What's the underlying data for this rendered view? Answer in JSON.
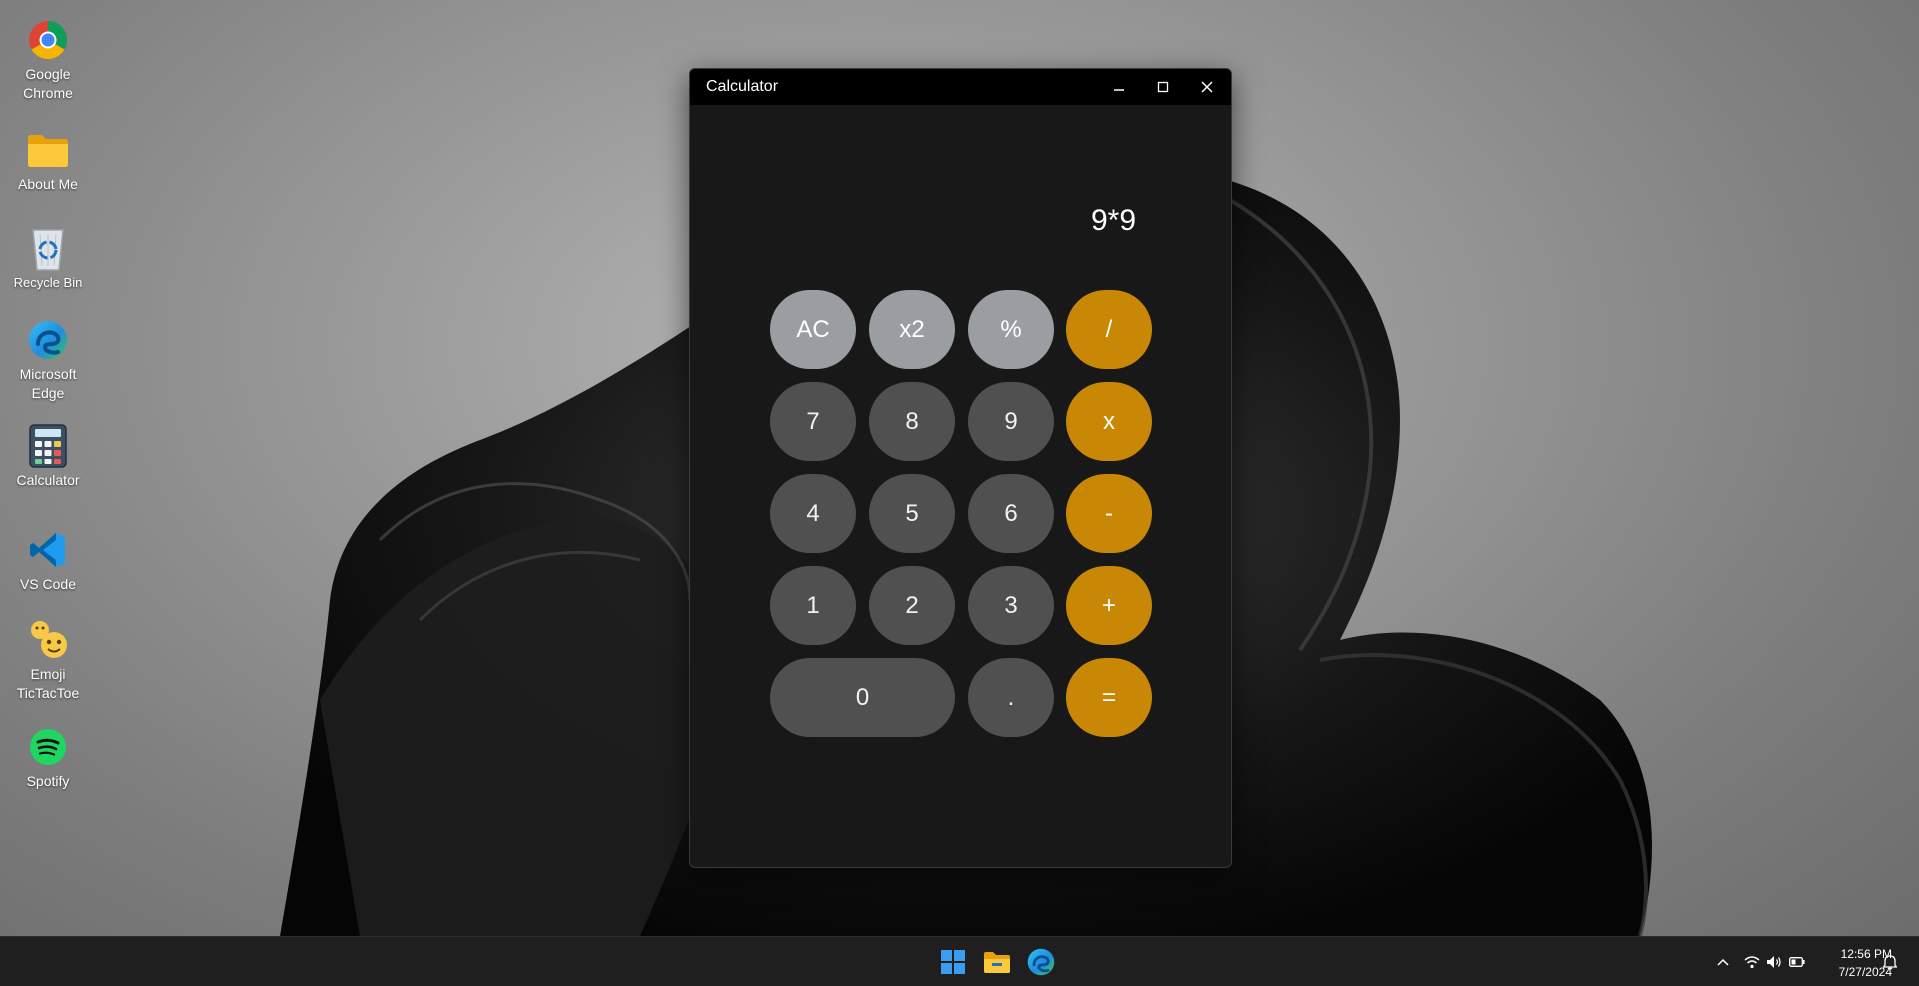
{
  "desktop": {
    "icons": [
      {
        "label": "Google\nChrome",
        "icon": "chrome-icon"
      },
      {
        "label": "About Me",
        "icon": "folder-icon"
      },
      {
        "label": "Recycle Bin",
        "icon": "recycle-bin-icon"
      },
      {
        "label": "Microsoft\nEdge",
        "icon": "edge-icon"
      },
      {
        "label": "Calculator",
        "icon": "calculator-icon"
      },
      {
        "label": "VS Code",
        "icon": "vscode-icon"
      },
      {
        "label": "Emoji\nTicTacToe",
        "icon": "emoji-icon"
      },
      {
        "label": "Spotify",
        "icon": "spotify-icon"
      }
    ]
  },
  "window": {
    "title": "Calculator",
    "controls": {
      "minimize": "minimize-icon",
      "maximize": "maximize-icon",
      "close": "close-icon"
    }
  },
  "calculator": {
    "display": "9*9",
    "buttons": {
      "ac": "AC",
      "square": "x2",
      "percent": "%",
      "divide": "/",
      "seven": "7",
      "eight": "8",
      "nine": "9",
      "multiply": "x",
      "four": "4",
      "five": "5",
      "six": "6",
      "subtract": "-",
      "one": "1",
      "two": "2",
      "three": "3",
      "add": "+",
      "zero": "0",
      "decimal": ".",
      "equals": "="
    },
    "colors": {
      "function": "#9a9ea3",
      "number": "#505050",
      "operator": "#c98706"
    }
  },
  "taskbar": {
    "apps": [
      "windows-start-icon",
      "file-explorer-icon",
      "edge-icon"
    ],
    "tray": [
      "chevron-up-icon",
      "wifi-icon",
      "volume-icon",
      "battery-icon",
      "notification-bell-icon"
    ],
    "time": "12:56 PM",
    "date": "7/27/2024"
  }
}
